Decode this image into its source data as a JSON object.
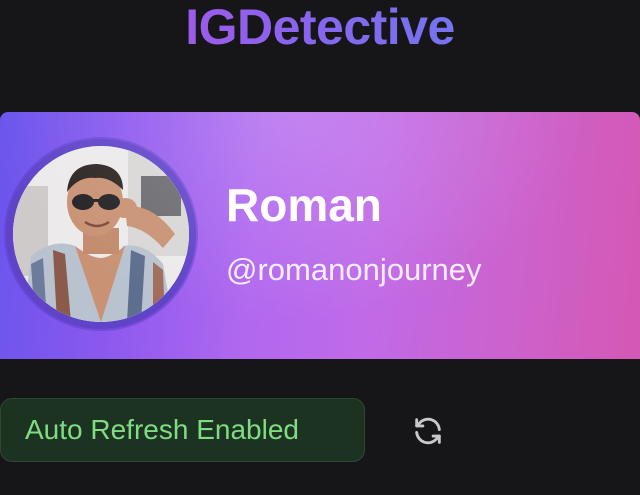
{
  "app": {
    "title": "IGDetective"
  },
  "profile": {
    "name": "Roman",
    "handle": "@romanonjourney"
  },
  "status": {
    "auto_refresh_label": "Auto Refresh Enabled"
  },
  "icons": {
    "refresh": "refresh-icon",
    "avatar": "profile-photo"
  },
  "colors": {
    "background": "#161618",
    "title_gradient_start": "#c14be0",
    "title_gradient_end": "#5c87f2",
    "card_gradient_start": "#6a55ec",
    "card_gradient_end": "#d558b4",
    "badge_text": "#7fdc82",
    "badge_background": "#1d3322"
  }
}
